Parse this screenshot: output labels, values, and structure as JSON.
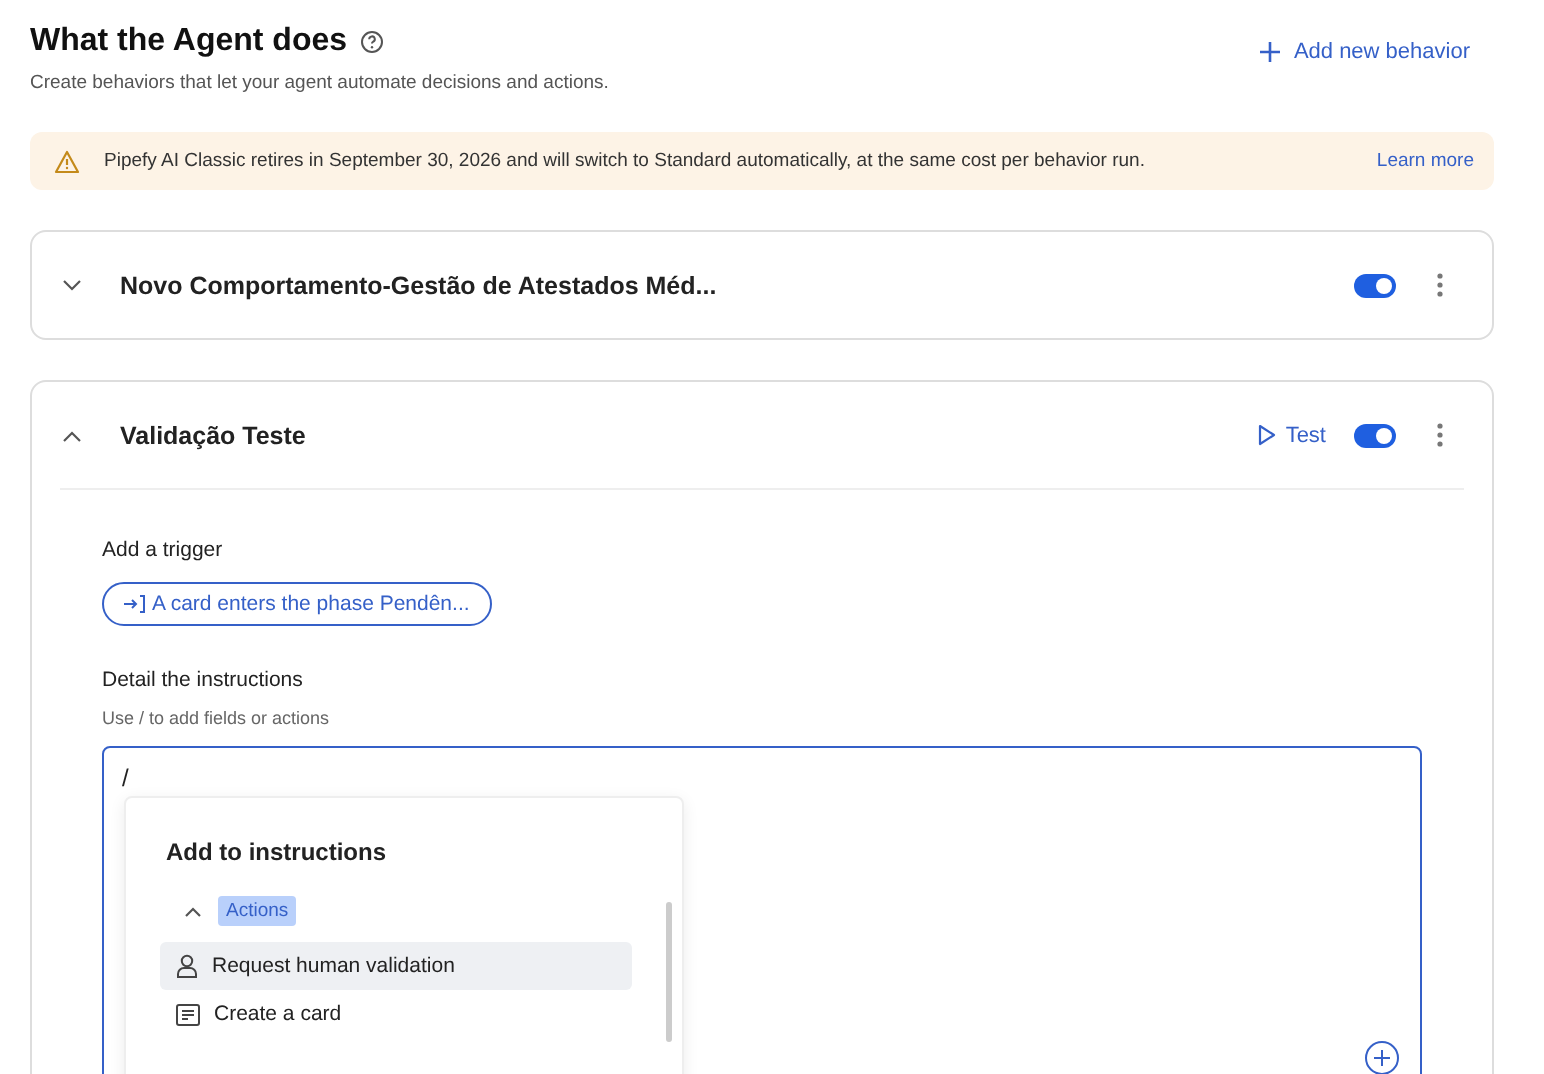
{
  "header": {
    "title": "What the Agent does",
    "subtitle": "Create behaviors that let your agent automate decisions and actions.",
    "add_button": "Add new behavior"
  },
  "banner": {
    "message": "Pipefy AI Classic retires in September 30, 2026 and will switch to Standard automatically, at the same cost per behavior run.",
    "link": "Learn more"
  },
  "behaviors": [
    {
      "title": "Novo Comportamento-Gestão de Atestados Méd...",
      "expanded": false,
      "enabled": true
    },
    {
      "title": "Validação Teste",
      "expanded": true,
      "enabled": true,
      "test_button": "Test",
      "trigger_label": "Add a trigger",
      "trigger": "A card enters the phase Pendên...",
      "instructions_label": "Detail the instructions",
      "instructions_hint": "Use / to add fields or actions",
      "instructions_value": "/",
      "menu": {
        "title": "Add to instructions",
        "groups": [
          {
            "label": "Actions",
            "expanded": true,
            "items": [
              {
                "kind": "person",
                "label": "Request human validation",
                "selected": true
              },
              {
                "kind": "card",
                "label": "Create a card",
                "selected": false
              }
            ]
          }
        ]
      }
    }
  ]
}
